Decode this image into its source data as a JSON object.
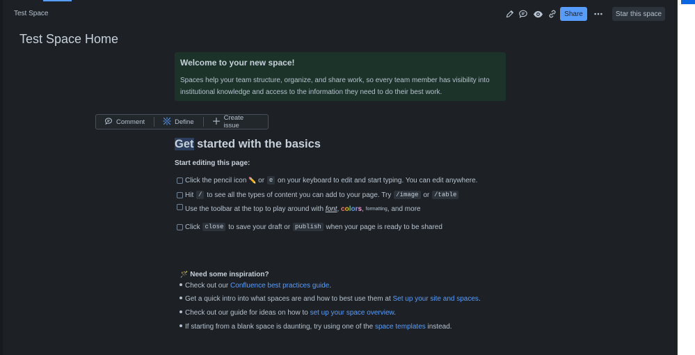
{
  "header": {
    "space_name": "Test Space",
    "share_label": "Share",
    "star_label": "Star this space",
    "icons": [
      "pencil-icon",
      "comment-icon",
      "eye-icon",
      "link-icon",
      "more-icon"
    ]
  },
  "page": {
    "title": "Test Space Home"
  },
  "panel": {
    "title": "Welcome to your new space!",
    "body": "Spaces help your team structure, organize, and share work, so every team member has visibility into institutional knowledge and access to the information they need to do their best work."
  },
  "toolbar": {
    "comment": "Comment",
    "define": "Define",
    "create_issue": "Create issue"
  },
  "content": {
    "heading_selected": "Get",
    "heading_rest": " started with the basics",
    "subheading": "Start editing this page:",
    "tasks": {
      "t1": {
        "a": "Click the pencil icon",
        "emoji": "✏️",
        "b": "or",
        "code": "e",
        "c": "on your keyboard to edit and start typing. You can edit anywhere."
      },
      "t2": {
        "a": "Hit",
        "code1": "/",
        "b": "to see all the types of content you can add to your page. Try",
        "code2": "/image",
        "c": "or",
        "code3": "/table"
      },
      "t3": {
        "a": "Use the toolbar at the top to play around with",
        "font": "font",
        "comma1": ",",
        "colors": [
          "c",
          "o",
          "l",
          "o",
          "r",
          "s"
        ],
        "comma2": ",",
        "formatt": "formatt",
        "ing": "ing",
        "c": ", and more"
      },
      "t4": {
        "a": "Click",
        "code1": "close",
        "b": "to save your draft or",
        "code2": "publish",
        "c": "when your page is ready to be shared"
      }
    },
    "inspiration": {
      "emoji": "🪄",
      "title": "Need some inspiration?",
      "b1": {
        "a": "Check out our",
        "link": "Confluence best practices guide",
        "c": "."
      },
      "b2": {
        "a": "Get a quick intro into what spaces are and how to best use them at",
        "link": "Set up your site and spaces",
        "c": "."
      },
      "b3": {
        "a": "Check out our guide for ideas on how to",
        "link": "set up your space overview",
        "c": "."
      },
      "b4": {
        "a": "If starting from a blank space is daunting, try using one of the",
        "link": "space templates",
        "c": "instead."
      }
    }
  },
  "colors": {
    "accent": "#579dff",
    "panel_bg": "#1c3329",
    "rainbow": [
      "#f87168",
      "#e2b203",
      "#4bce97",
      "#579dff",
      "#9f8fef",
      "#f797d2"
    ]
  }
}
